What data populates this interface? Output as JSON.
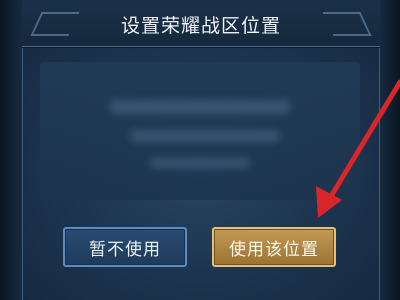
{
  "dialog": {
    "title": "设置荣耀战区位置",
    "cancel_label": "暂不使用",
    "confirm_label": "使用该位置"
  },
  "colors": {
    "annotation_arrow": "#d9262a",
    "confirm_accent": "#c49a55",
    "cancel_accent": "#5b8dc0"
  }
}
